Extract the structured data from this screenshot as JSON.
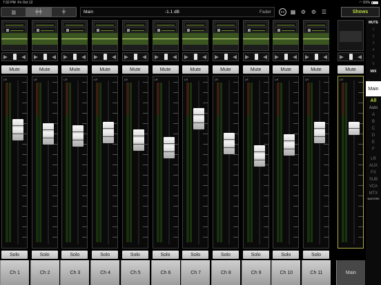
{
  "status_bar": {
    "time": "7:32 PM",
    "date": "Fri Oct 12",
    "battery": "91%"
  },
  "topbar": {
    "display_name": "Main",
    "display_value": "-1.1 dB",
    "display_param": "Fader",
    "fx_label": "FX",
    "shows_label": "Shows",
    "icons": [
      "mixer-view-icon",
      "faders-view-icon",
      "single-fader-icon",
      "fx-icon",
      "keyboard-icon",
      "settings-gear-icon",
      "routing-icon",
      "options-icon"
    ]
  },
  "channels": [
    {
      "label": "Ch 1",
      "number": "1",
      "level": 0.74
    },
    {
      "label": "Ch 2",
      "number": "2",
      "level": 0.71
    },
    {
      "label": "Ch 3",
      "number": "3",
      "level": 0.7
    },
    {
      "label": "Ch 4",
      "number": "4",
      "level": 0.72
    },
    {
      "label": "Ch 5",
      "number": "5",
      "level": 0.67
    },
    {
      "label": "Ch 6",
      "number": "6",
      "level": 0.62
    },
    {
      "label": "Ch 7",
      "number": "7",
      "level": 0.81
    },
    {
      "label": "Ch 8",
      "number": "8",
      "level": 0.65
    },
    {
      "label": "Ch 9",
      "number": "9",
      "level": 0.57
    },
    {
      "label": "Ch 10",
      "number": "10",
      "level": 0.64
    },
    {
      "label": "Ch 11",
      "number": "11",
      "level": 0.72
    }
  ],
  "strip_labels": {
    "lr": "LR",
    "mute": "Mute",
    "solo": "Solo"
  },
  "main": {
    "label": "Main",
    "level": 0.72
  },
  "right_panel": {
    "mute_header": "MUTE",
    "mute_groups": [
      "1",
      "2",
      "3",
      "4",
      "5",
      "6"
    ],
    "mix_header": "MIX",
    "mix_lr": "LR",
    "mix_selected": "Main",
    "view_groups": [
      "All",
      "Auto",
      "A",
      "B",
      "C",
      "D",
      "E",
      "F"
    ],
    "layer_groups": [
      "LR",
      "AUX",
      "FX",
      "SUB",
      "VCA",
      "MTX"
    ],
    "masters_label": "MASTERS"
  },
  "colors": {
    "accent_green": "#b9dc3c",
    "main_border": "#b6b14a"
  }
}
